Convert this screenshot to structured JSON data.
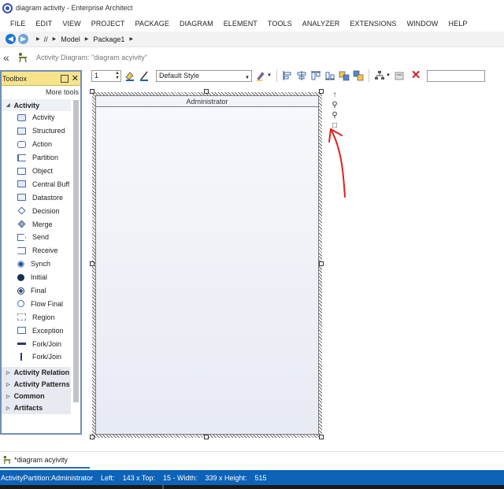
{
  "window": {
    "title": "diagram activity - Enterprise Architect"
  },
  "menu": [
    "FILE",
    "EDIT",
    "VIEW",
    "PROJECT",
    "PACKAGE",
    "DIAGRAM",
    "ELEMENT",
    "TOOLS",
    "ANALYZER",
    "EXTENSIONS",
    "WINDOW",
    "HELP"
  ],
  "navigation": {
    "breadcrumb": [
      "//",
      "Model",
      "Package1"
    ]
  },
  "diagram_header": {
    "caption": "Activity Diagram: \"diagram acyivity\""
  },
  "toolbox": {
    "title": "Toolbox",
    "more_tools": "More tools",
    "open_category": "Activity",
    "items": [
      {
        "label": "Activity",
        "icon": "activity-icon"
      },
      {
        "label": "Structured",
        "icon": "structured-activity-icon"
      },
      {
        "label": "Action",
        "icon": "action-icon"
      },
      {
        "label": "Partition",
        "icon": "partition-icon"
      },
      {
        "label": "Object",
        "icon": "object-icon"
      },
      {
        "label": "Central Buffer",
        "icon": "central-buffer-icon"
      },
      {
        "label": "Datastore",
        "icon": "datastore-icon"
      },
      {
        "label": "Decision",
        "icon": "decision-icon"
      },
      {
        "label": "Merge",
        "icon": "merge-icon"
      },
      {
        "label": "Send",
        "icon": "send-icon"
      },
      {
        "label": "Receive",
        "icon": "receive-icon"
      },
      {
        "label": "Synch",
        "icon": "synch-icon"
      },
      {
        "label": "Initial",
        "icon": "initial-node-icon"
      },
      {
        "label": "Final",
        "icon": "final-node-icon"
      },
      {
        "label": "Flow Final",
        "icon": "flow-final-icon"
      },
      {
        "label": "Region",
        "icon": "region-icon"
      },
      {
        "label": "Exception",
        "icon": "exception-icon"
      },
      {
        "label": "Fork/Join",
        "icon": "fork-join-horizontal-icon"
      },
      {
        "label": "Fork/Join",
        "icon": "fork-join-vertical-icon"
      }
    ],
    "collapsed_categories": [
      "Activity Relationships",
      "Activity Patterns",
      "Common",
      "Artifacts"
    ]
  },
  "diagram_toolbar": {
    "line_width": "1",
    "style": "Default Style"
  },
  "canvas": {
    "partition_name": "Administrator"
  },
  "document_tabs": [
    {
      "label": "*diagram acyivity"
    }
  ],
  "status": {
    "element": "ActivityPartition:Administrator",
    "left_label": "Left:",
    "left_value": "143 x Top:",
    "top_value": "15 - Width:",
    "width_value": "339 x Height:",
    "height_value": "515"
  },
  "colors": {
    "statusbar": "#0c63b8",
    "toolbox_header": "#f7e48a",
    "annotation_arrow": "#e02020"
  }
}
